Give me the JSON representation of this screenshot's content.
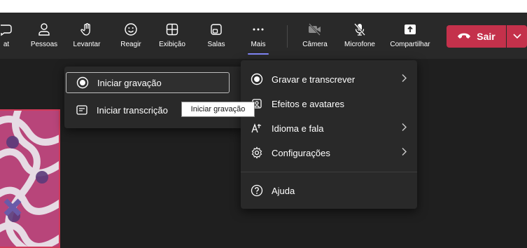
{
  "toolbar": {
    "items": [
      {
        "label": "at",
        "icon": "chat-icon"
      },
      {
        "label": "Pessoas",
        "icon": "people-icon"
      },
      {
        "label": "Levantar",
        "icon": "raise-hand-icon"
      },
      {
        "label": "Reagir",
        "icon": "smiley-icon"
      },
      {
        "label": "Exibição",
        "icon": "grid-view-icon"
      },
      {
        "label": "Salas",
        "icon": "rooms-icon"
      },
      {
        "label": "Mais",
        "icon": "more-dots-icon"
      },
      {
        "label": "Câmera",
        "icon": "camera-off-icon"
      },
      {
        "label": "Microfone",
        "icon": "mic-off-icon"
      },
      {
        "label": "Compartilhar",
        "icon": "share-icon"
      }
    ],
    "leave_label": "Sair",
    "accent": "#7f85f5",
    "leave_color": "#c4314b"
  },
  "recording_submenu": {
    "items": [
      {
        "label": "Iniciar gravação",
        "icon": "record-icon"
      },
      {
        "label": "Iniciar transcrição",
        "icon": "transcript-icon"
      }
    ]
  },
  "tooltip": "Iniciar gravação",
  "more_menu": {
    "items": [
      {
        "label": "Gravar e transcrever",
        "icon": "record-icon",
        "has_submenu": true
      },
      {
        "label": "Efeitos e avatares",
        "icon": "effects-icon",
        "has_submenu": false
      },
      {
        "label": "Idioma e fala",
        "icon": "language-icon",
        "has_submenu": true
      },
      {
        "label": "Configurações",
        "icon": "gear-icon",
        "has_submenu": true
      },
      {
        "label": "Ajuda",
        "icon": "help-icon",
        "has_submenu": false
      }
    ]
  }
}
